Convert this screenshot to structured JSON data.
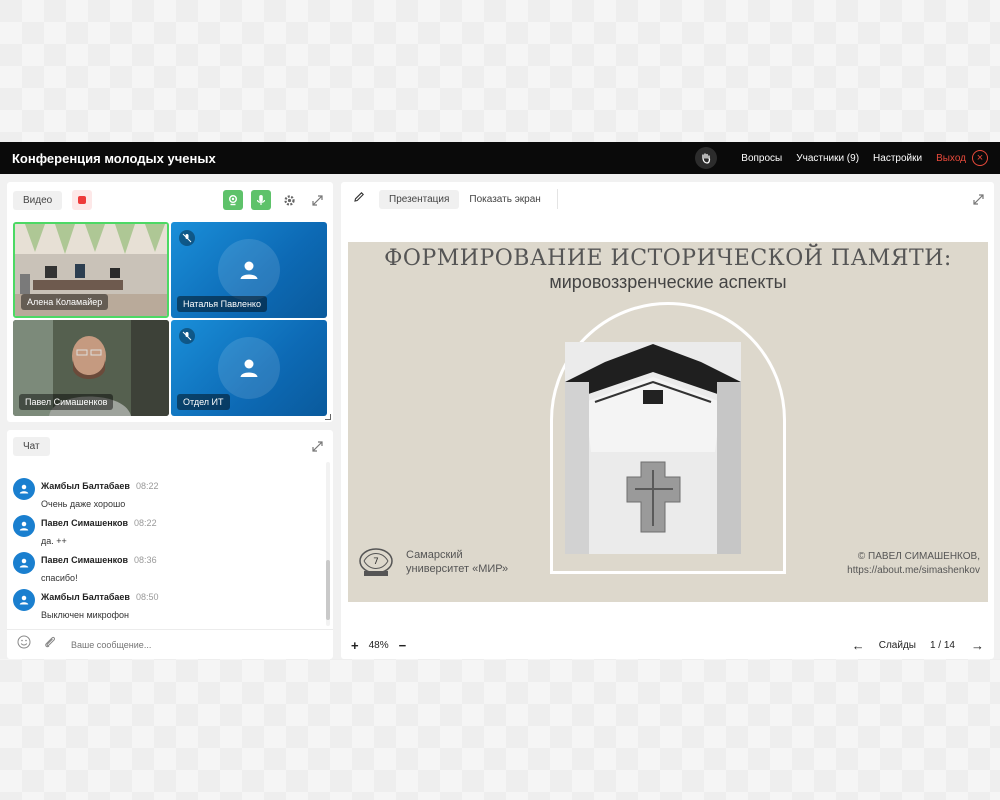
{
  "app": {
    "title": "Конференция молодых ученых",
    "nav": {
      "questions": "Вопросы",
      "participants": "Участники (9)",
      "settings": "Настройки",
      "exit": "Выход"
    }
  },
  "video": {
    "tab_label": "Видео",
    "tiles": [
      {
        "name": "Алена Коламайер",
        "active": true
      },
      {
        "name": "Наталья Павленко",
        "muted": true
      },
      {
        "name": "Павел Симашенков"
      },
      {
        "name": "Отдел ИТ",
        "muted": true
      }
    ]
  },
  "chat": {
    "tab_label": "Чат",
    "messages": [
      {
        "author": "Жамбыл Балтабаев",
        "time": "08:22",
        "text": "Очень даже хорошо"
      },
      {
        "author": "Павел Симашенков",
        "time": "08:22",
        "text": "да. ++"
      },
      {
        "author": "Павел Симашенков",
        "time": "08:36",
        "text": "спасибо!"
      },
      {
        "author": "Жамбыл Балтабаев",
        "time": "08:50",
        "text": "Выключен микрофон"
      }
    ],
    "input_placeholder": "Ваше сообщение..."
  },
  "presentation": {
    "tabs": [
      "Презентация",
      "Показать экран"
    ],
    "slide": {
      "title": "ФОРМИРОВАНИЕ ИСТОРИЧЕСКОЙ ПАМЯТИ:",
      "subtitle": "мировоззренческие аспекты",
      "org_line1": "Самарский",
      "org_line2": "университет «МИР»",
      "copyright_line1": "© ПАВЕЛ СИМАШЕНКОВ,",
      "copyright_line2": "https://about.me/simashenkov"
    },
    "zoom": "48%",
    "slides_label": "Слайды",
    "slides_pos": "1 / 14"
  },
  "colors": {
    "topbar": "#0a0a0a",
    "exit": "#e84a3b",
    "accent_green": "#5ec26a",
    "tile_blue": "#1a8fd9",
    "slide_bg": "#ddd8cc"
  }
}
